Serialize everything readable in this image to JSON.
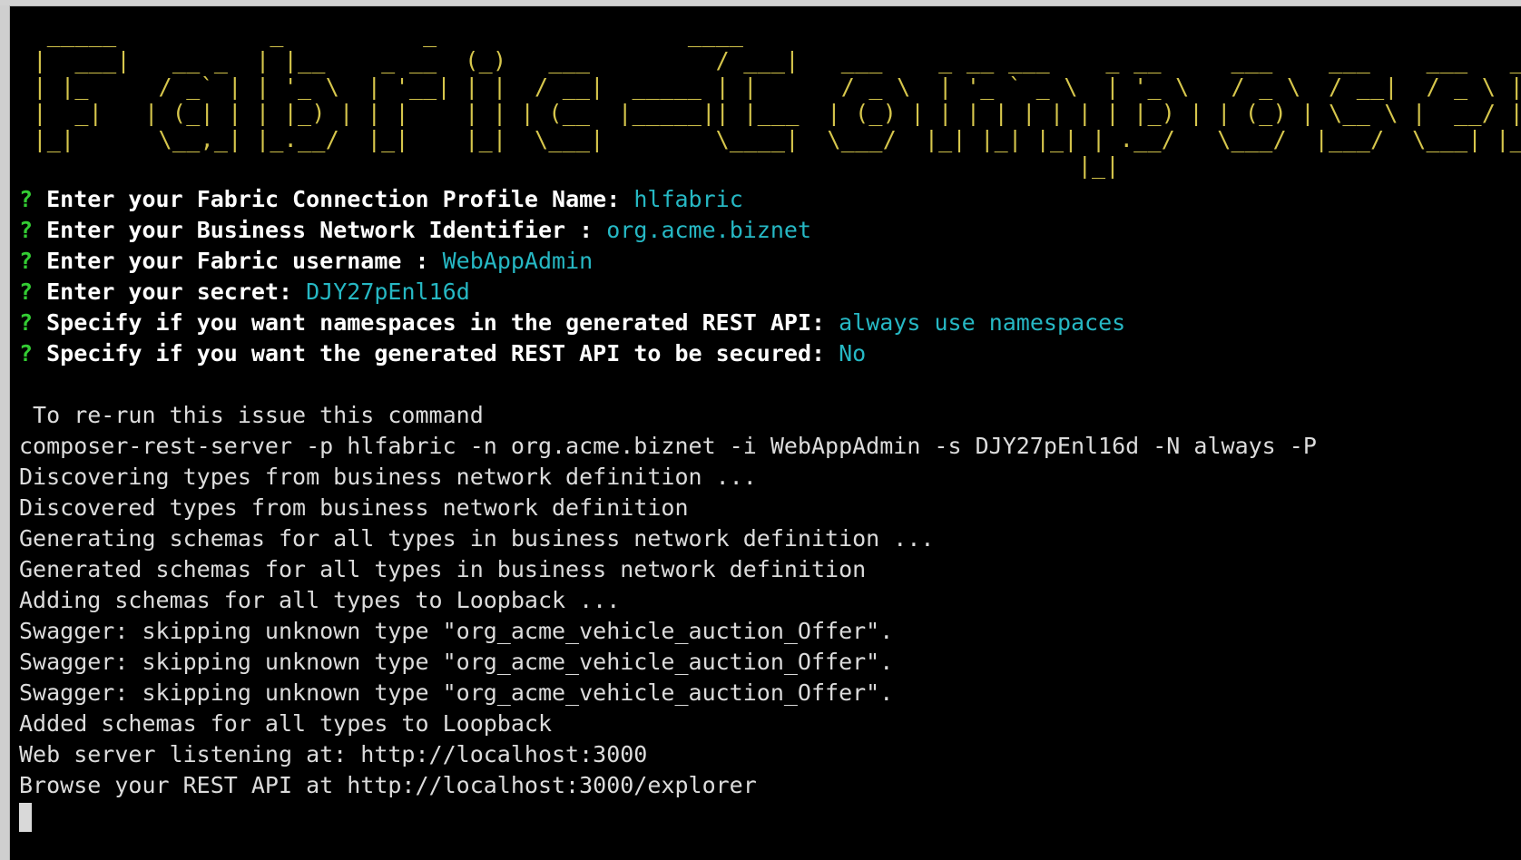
{
  "banner": {
    "title": "Fabric-Composer",
    "ascii_art": "  _____           _          _                  ____\n |  ___|   __ _  | |__    _ __  (_)   ___         / ___|   ___    _ __ ___    _ __     ___    ___    ___   _ __\n | |_     / _` | | '_ \\  | '__| | |  / __|  _____ | |      / _ \\  | '_ ` _ \\  | '_ \\   / _ \\  / __|  / _ \\ | '__|\n |  _|   | (_| | | |_) | | |    | | | (__  |_____|| |___  | (_) | | | | | | | | |_) | | (_) | \\__ \\ |  __/ | |\n |_|      \\__,_| |_.__/  |_|    |_|  \\___|        \\____|  \\___/  |_| |_| |_| | .__/   \\___/  |___/  \\___| |_|\n                                                                            |_|"
  },
  "prompts": [
    {
      "mark": "?",
      "question": "Enter your Fabric Connection Profile Name:",
      "answer": "hlfabric"
    },
    {
      "mark": "?",
      "question": "Enter your Business Network Identifier :",
      "answer": "org.acme.biznet"
    },
    {
      "mark": "?",
      "question": "Enter your Fabric username :",
      "answer": "WebAppAdmin"
    },
    {
      "mark": "?",
      "question": "Enter your secret:",
      "answer": "DJY27pEnl16d"
    },
    {
      "mark": "?",
      "question": "Specify if you want namespaces in the generated REST API:",
      "answer": "always use namespaces"
    },
    {
      "mark": "?",
      "question": "Specify if you want the generated REST API to be secured:",
      "answer": "No"
    }
  ],
  "output": [
    " To re-run this issue this command",
    "composer-rest-server -p hlfabric -n org.acme.biznet -i WebAppAdmin -s DJY27pEnl16d -N always -P",
    "Discovering types from business network definition ...",
    "Discovered types from business network definition",
    "Generating schemas for all types in business network definition ...",
    "Generated schemas for all types in business network definition",
    "Adding schemas for all types to Loopback ...",
    "Swagger: skipping unknown type \"org_acme_vehicle_auction_Offer\".",
    "Swagger: skipping unknown type \"org_acme_vehicle_auction_Offer\".",
    "Swagger: skipping unknown type \"org_acme_vehicle_auction_Offer\".",
    "Added schemas for all types to Loopback",
    "Web server listening at: http://localhost:3000",
    "Browse your REST API at http://localhost:3000/explorer"
  ],
  "colors": {
    "background": "#000000",
    "banner": "#d6c64c",
    "prompt_mark": "#33cc33",
    "prompt_text": "#ffffff",
    "answer": "#26b8c4",
    "output": "#dcdcdc"
  }
}
